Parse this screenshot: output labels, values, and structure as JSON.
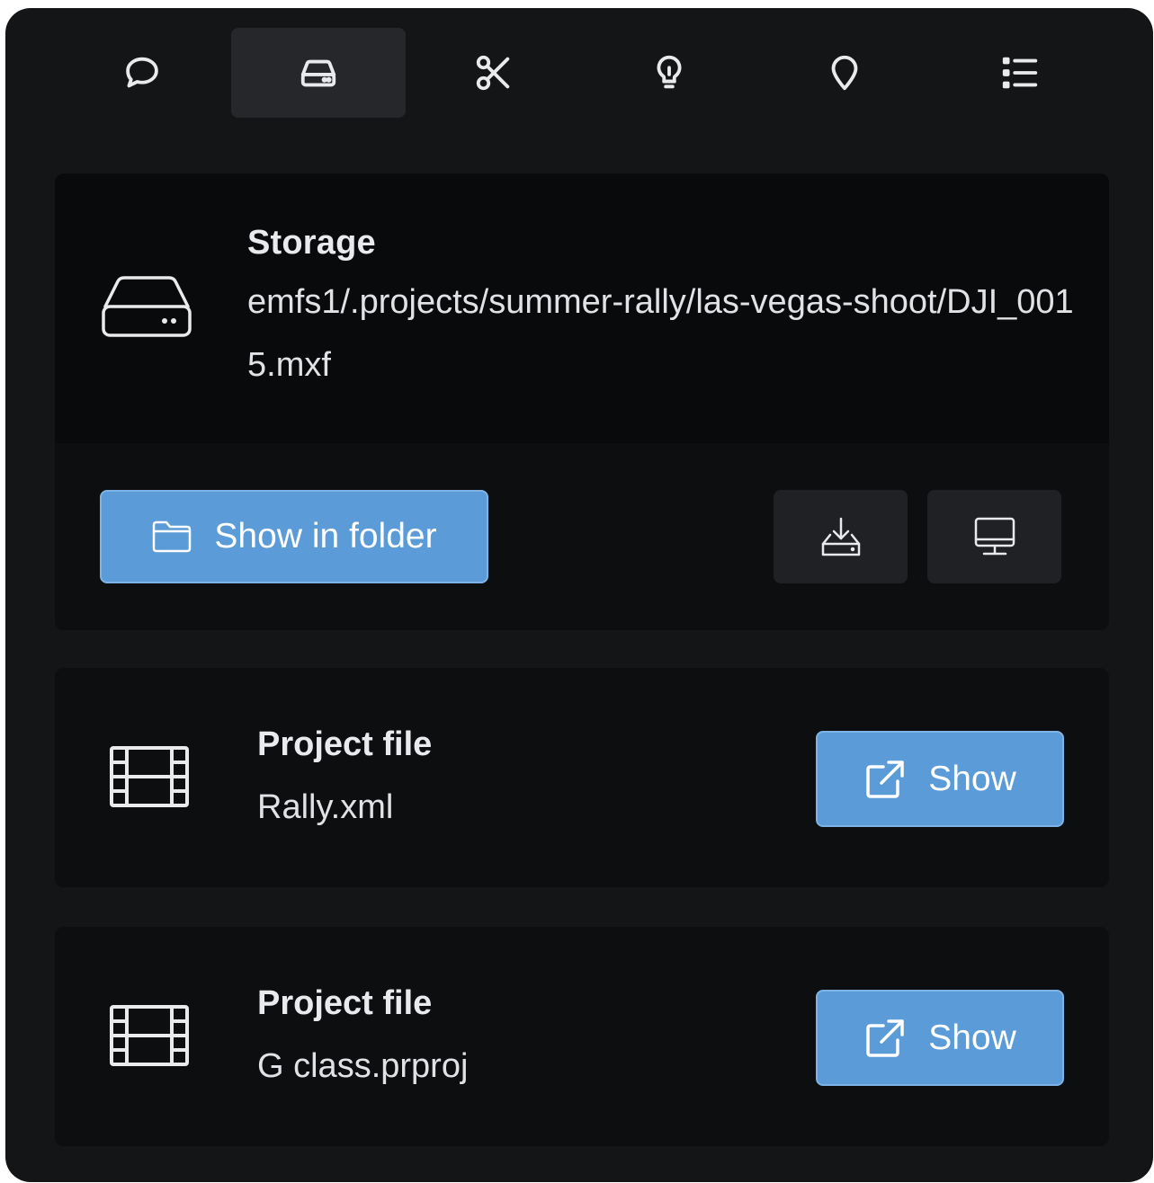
{
  "tabs": [
    {
      "name": "comment",
      "icon": "speech-bubble-icon",
      "active": false
    },
    {
      "name": "storage",
      "icon": "hard-drive-icon",
      "active": true
    },
    {
      "name": "edit",
      "icon": "scissors-icon",
      "active": false
    },
    {
      "name": "ideas",
      "icon": "lightbulb-icon",
      "active": false
    },
    {
      "name": "location",
      "icon": "map-pin-icon",
      "active": false
    },
    {
      "name": "list",
      "icon": "list-icon",
      "active": false
    }
  ],
  "storage": {
    "icon": "hard-drive-icon",
    "title": "Storage",
    "path": "emfs1/.projects/summer-rally/las-vegas-shoot/DJI_0015.mxf",
    "show_in_folder_label": "Show in folder",
    "download_icon": "download-tray-icon",
    "monitor_icon": "monitor-icon"
  },
  "project_files": [
    {
      "title": "Project file",
      "name": "Rally.xml",
      "show_label": "Show",
      "icon": "film-icon"
    },
    {
      "title": "Project file",
      "name": "G class.prproj",
      "show_label": "Show",
      "icon": "film-icon"
    }
  ],
  "colors": {
    "background": "#141517",
    "card": "#0c0e10",
    "accent": "#5a9bd8",
    "active_tab": "#25272a"
  }
}
